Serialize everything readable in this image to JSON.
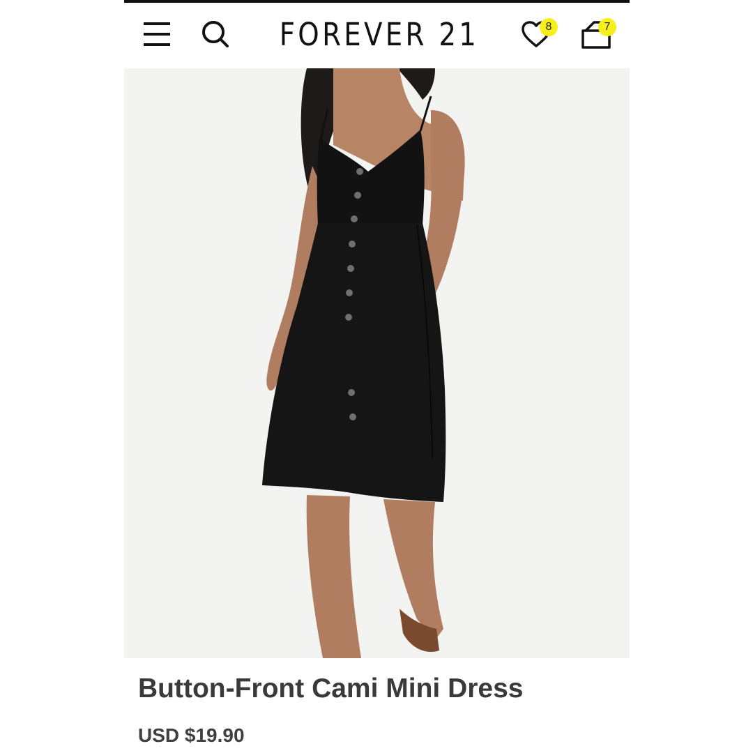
{
  "header": {
    "brand": "FOREVER 21",
    "menu_icon": "hamburger-menu-icon",
    "search_icon": "search-icon",
    "wishlist": {
      "icon": "heart-icon",
      "count": "8"
    },
    "bag": {
      "icon": "shopping-bag-icon",
      "count": "7"
    },
    "badge_color": "#f7ef1a"
  },
  "product": {
    "name": "Button-Front Cami Mini Dress",
    "price": "USD $19.90"
  }
}
